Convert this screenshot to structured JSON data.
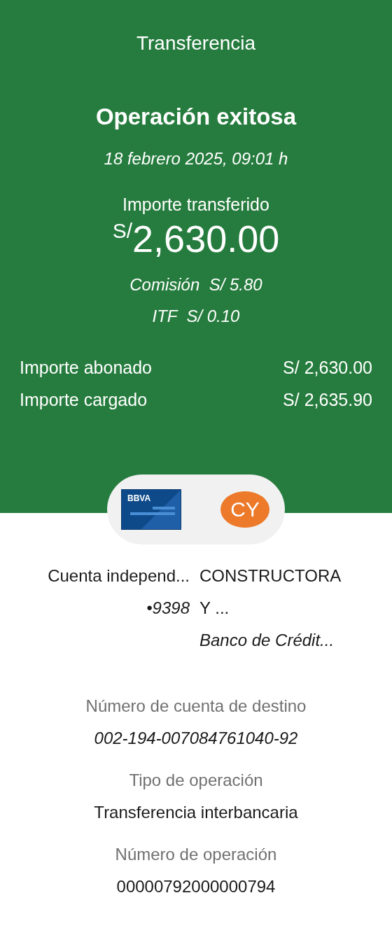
{
  "header": {
    "title": "Transferencia"
  },
  "status": {
    "title": "Operación exitosa",
    "datetime": "18 febrero 2025,  09:01 h"
  },
  "amount": {
    "label": "Importe transferido",
    "currency": "S/",
    "value": "2,630.00"
  },
  "fees": [
    {
      "label": "Comisión",
      "value": "S/ 5.80"
    },
    {
      "label": "ITF",
      "value": "S/ 0.10"
    }
  ],
  "totals": [
    {
      "label": "Importe abonado",
      "value": "S/ 2,630.00"
    },
    {
      "label": "Importe cargado",
      "value": "S/ 2,635.90"
    }
  ],
  "origin": {
    "card_logo": "BBVA",
    "name": "Cuenta independ...",
    "number": "•9398"
  },
  "destination": {
    "initials": "CY",
    "name_lines": [
      "CONSTRUCTORA",
      "Y ..."
    ],
    "bank": "Banco de Crédit..."
  },
  "details": [
    {
      "label": "Número de cuenta de destino",
      "value": "002-194-007084761040-92",
      "italic": true
    },
    {
      "label": "Tipo de operación",
      "value": "Transferencia interbancaria",
      "italic": false
    },
    {
      "label": "Número de operación",
      "value": "00000792000000794",
      "italic": false
    }
  ]
}
